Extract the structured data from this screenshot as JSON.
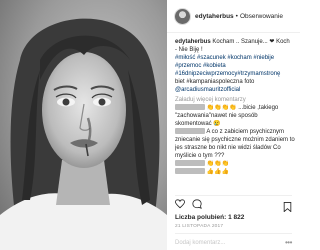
{
  "post_image": {
    "description_icon": "portrait-photo"
  },
  "header": {
    "username": "edytaherbus",
    "separator": "•",
    "follow_label": "Obserwowanie"
  },
  "caption": {
    "username": "edytaherbus",
    "text_line1": "Kocham .. Szanuje... ❤ Koch",
    "text_line2": "- Nie Biję !",
    "hashtags_line1": "#miłość #szacunek #kocham #niebije",
    "hashtags_line2": "#przemoc #kobieta",
    "hashtags_line3": "#16dnipzeciwprzemocy#trzymamstronę",
    "hashtags_line4": "biet #kampaniaspoleczna foto",
    "mention": "@arcadiusmauritzofficial"
  },
  "load_more_label": "Załaduj więcej komentarzy",
  "comments": [
    {
      "text": "👏👏👏👏 ...bicie ,takiego"
    },
    {
      "text": "\"zachowania\"nawet nie sposób"
    },
    {
      "text": "skomentować 😢"
    },
    {
      "text": "A co z zabiciem psychicznym"
    },
    {
      "text": "zniecanie się psychiczne możnim zdaniem to"
    },
    {
      "text": "jes straszne bo nikt nie widzi śladów Co"
    },
    {
      "text": "myślicie o tym ???"
    },
    {
      "text": "👏👏👏"
    },
    {
      "text": "👍👍👍"
    }
  ],
  "likes_label": "Liczba polubień: 1 822",
  "date_label": "21 LISTOPADA 2017",
  "add_comment_placeholder": "Dodaj komentarz...",
  "more_label": "•••"
}
